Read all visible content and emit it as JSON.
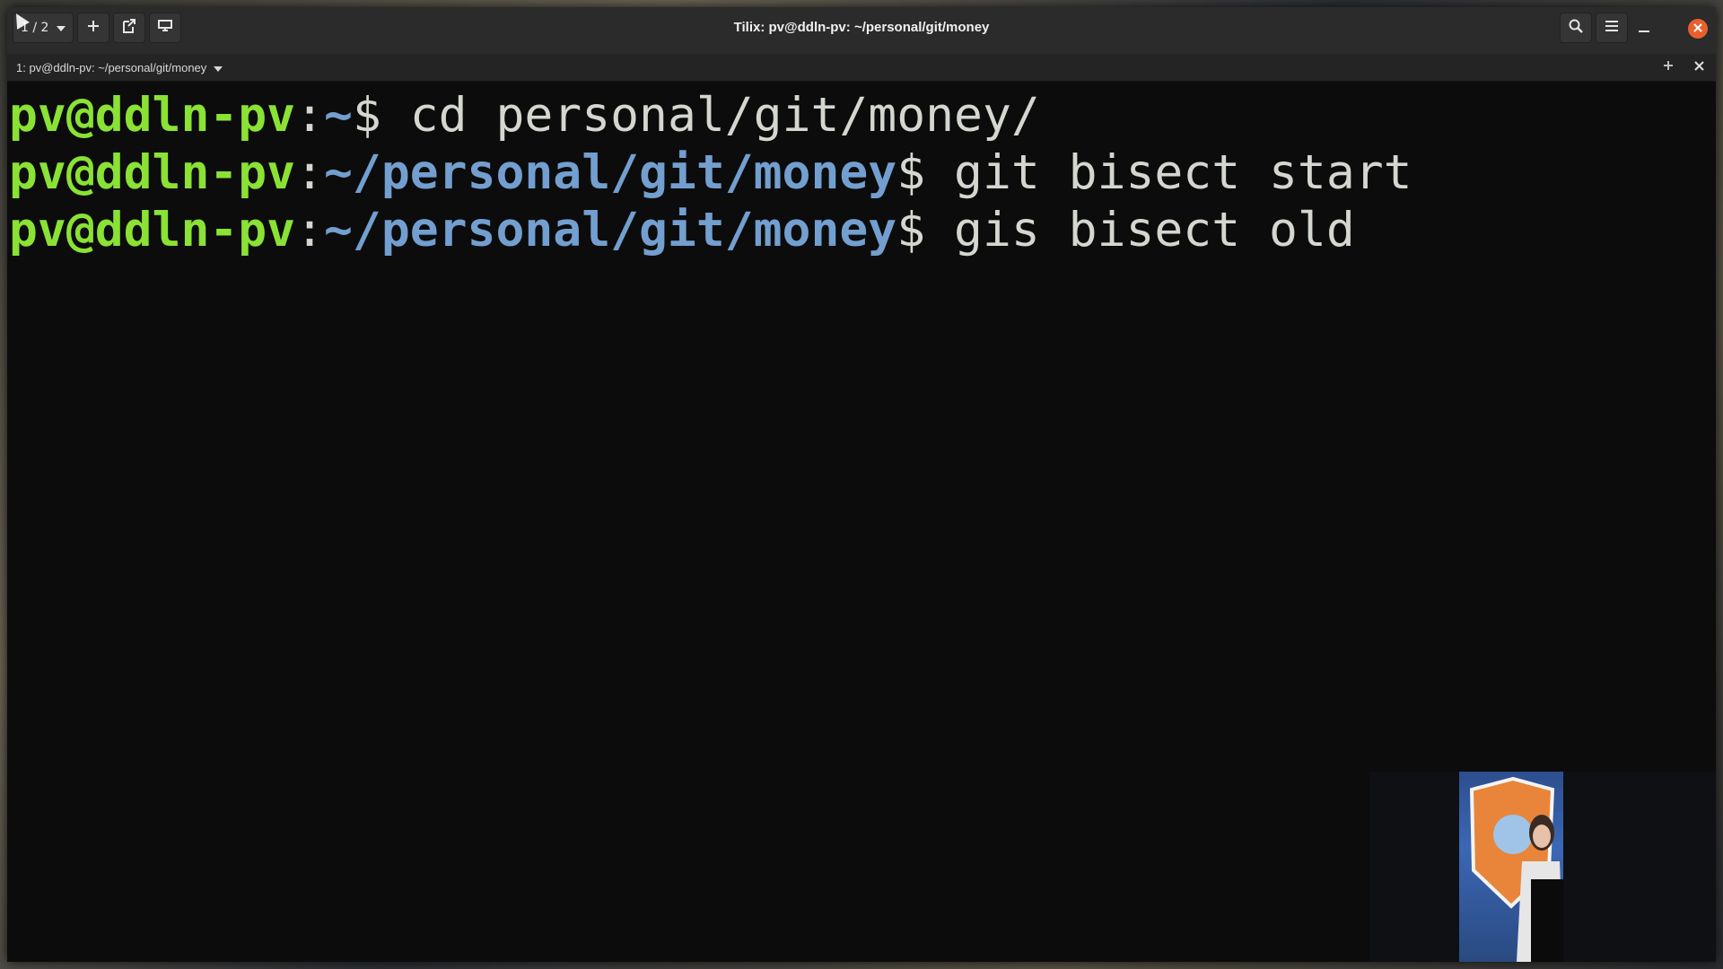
{
  "window": {
    "title": "Tilix: pv@ddln-pv: ~/personal/git/money"
  },
  "titlebar": {
    "session_switch_label": "1 / 2",
    "add_icon": "plus-icon",
    "detach_icon": "detach-icon",
    "sync_icon": "sync-input-icon",
    "search_icon": "search-icon",
    "menu_icon": "hamburger-menu-icon",
    "minimize_icon": "minimize-icon",
    "close_icon": "close-icon"
  },
  "terminal_tab": {
    "title": "1: pv@ddln-pv: ~/personal/git/money",
    "add_icon": "plus-icon",
    "close_icon": "close-icon"
  },
  "terminal": {
    "lines": [
      {
        "user": "pv@ddln-pv",
        "sep": ":",
        "path": "~",
        "prompt": "$ ",
        "command": "cd personal/git/money/"
      },
      {
        "user": "pv@ddln-pv",
        "sep": ":",
        "path": "~/personal/git/money",
        "prompt": "$ ",
        "command": "git bisect start"
      },
      {
        "user": "pv@ddln-pv",
        "sep": ":",
        "path": "~/personal/git/money",
        "prompt": "$ ",
        "command": "gis bisect old"
      }
    ]
  },
  "colors": {
    "user": "#8ae234",
    "path": "#729fcf",
    "text": "#d3d7cf",
    "close_button": "#e8602c"
  }
}
